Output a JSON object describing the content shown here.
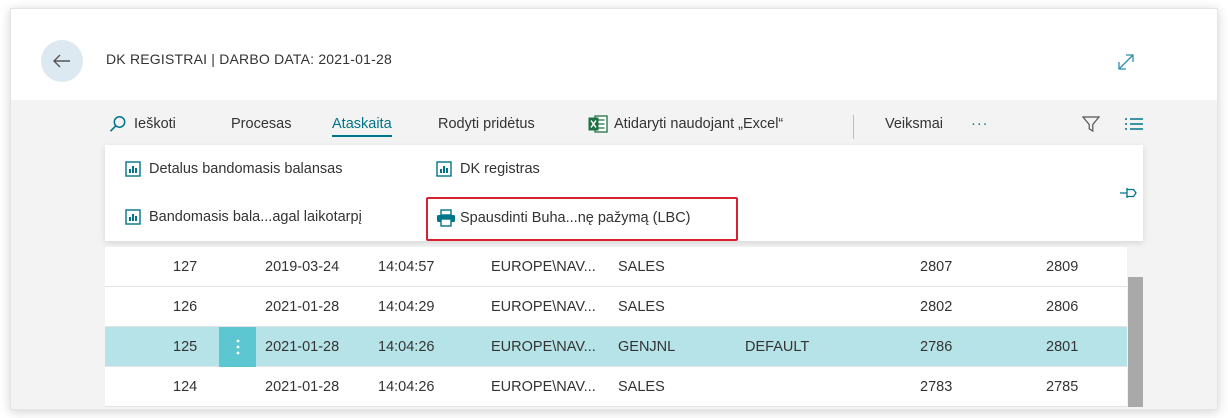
{
  "header": {
    "title": "DK REGISTRAI | DARBO DATA: 2021-01-28"
  },
  "actionbar": {
    "search_label": "Ieškoti",
    "process_label": "Procesas",
    "reports_label": "Ataskaita",
    "show_attached_label": "Rodyti pridėtus",
    "excel_label": "Atidaryti naudojant „Excel“",
    "actions_label": "Veiksmai",
    "more_label": "···"
  },
  "reports_menu": {
    "items": [
      {
        "label": "Detalus bandomasis balansas"
      },
      {
        "label": "DK registras"
      },
      {
        "label": "Bandomasis bala...agal laikotarpį"
      },
      {
        "label": "Spausdinti Buha...nę pažymą (LBC)"
      }
    ]
  },
  "table": {
    "rows": [
      {
        "no": "127",
        "date": "2019-03-24",
        "time": "14:04:57",
        "user": "EUROPE\\NAV...",
        "source": "SALES",
        "batch": "",
        "from": "2807",
        "to": "2809",
        "selected": false
      },
      {
        "no": "126",
        "date": "2021-01-28",
        "time": "14:04:29",
        "user": "EUROPE\\NAV...",
        "source": "SALES",
        "batch": "",
        "from": "2802",
        "to": "2806",
        "selected": false
      },
      {
        "no": "125",
        "date": "2021-01-28",
        "time": "14:04:26",
        "user": "EUROPE\\NAV...",
        "source": "GENJNL",
        "batch": "DEFAULT",
        "from": "2786",
        "to": "2801",
        "selected": true
      },
      {
        "no": "124",
        "date": "2021-01-28",
        "time": "14:04:26",
        "user": "EUROPE\\NAV...",
        "source": "SALES",
        "batch": "",
        "from": "2783",
        "to": "2785",
        "selected": false
      }
    ]
  },
  "colors": {
    "accent": "#00758a",
    "selected_row": "#b6e3e8",
    "row_menu": "#5cc6d1",
    "highlight": "#d6212f"
  }
}
